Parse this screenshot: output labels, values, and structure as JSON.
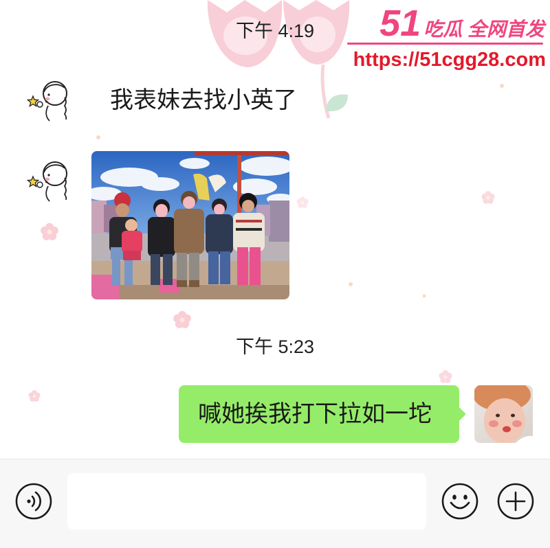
{
  "watermark": {
    "brand_number": "51",
    "brand_text": "吃瓜 全网首发",
    "url": "https://51cgg28.com"
  },
  "timestamps": {
    "first": "下午 4:19",
    "second": "下午 5:23"
  },
  "conversation": {
    "received": [
      {
        "text": "我表妹去找小英了",
        "avatar_icon": "cartoon-girl-avatar"
      },
      {
        "image_icon": "group-photo-image",
        "avatar_icon": "cartoon-girl-avatar"
      }
    ],
    "sent": [
      {
        "text": "喊她挨我打下拉如一坨",
        "avatar_icon": "child-photo-avatar"
      }
    ]
  },
  "input_bar": {
    "voice_icon": "voice-icon",
    "emoji_icon": "emoji-icon",
    "plus_icon": "plus-icon"
  },
  "colors": {
    "sent_bubble": "#95ec69",
    "received_bubble": "#ffffff",
    "input_bar": "#f7f7f7",
    "text": "#191919",
    "watermark": "#f0457f",
    "watermark_url": "#e3192b",
    "star": "#ffd43b"
  }
}
